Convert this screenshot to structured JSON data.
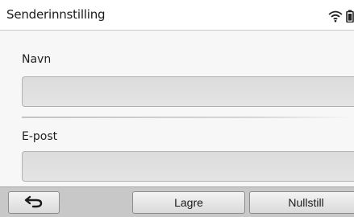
{
  "header": {
    "title": "Senderinnstilling",
    "icons": [
      "wifi-icon",
      "battery-icon"
    ]
  },
  "form": {
    "name_label": "Navn",
    "name_value": "",
    "email_label": "E-post",
    "email_value": ""
  },
  "toolbar": {
    "back_icon": "back-arrow-icon",
    "save_label": "Lagre",
    "reset_label": "Nullstill"
  },
  "colors": {
    "field_fill": "#dcdcdc",
    "toolbar_bg": "#c8c8c8"
  }
}
